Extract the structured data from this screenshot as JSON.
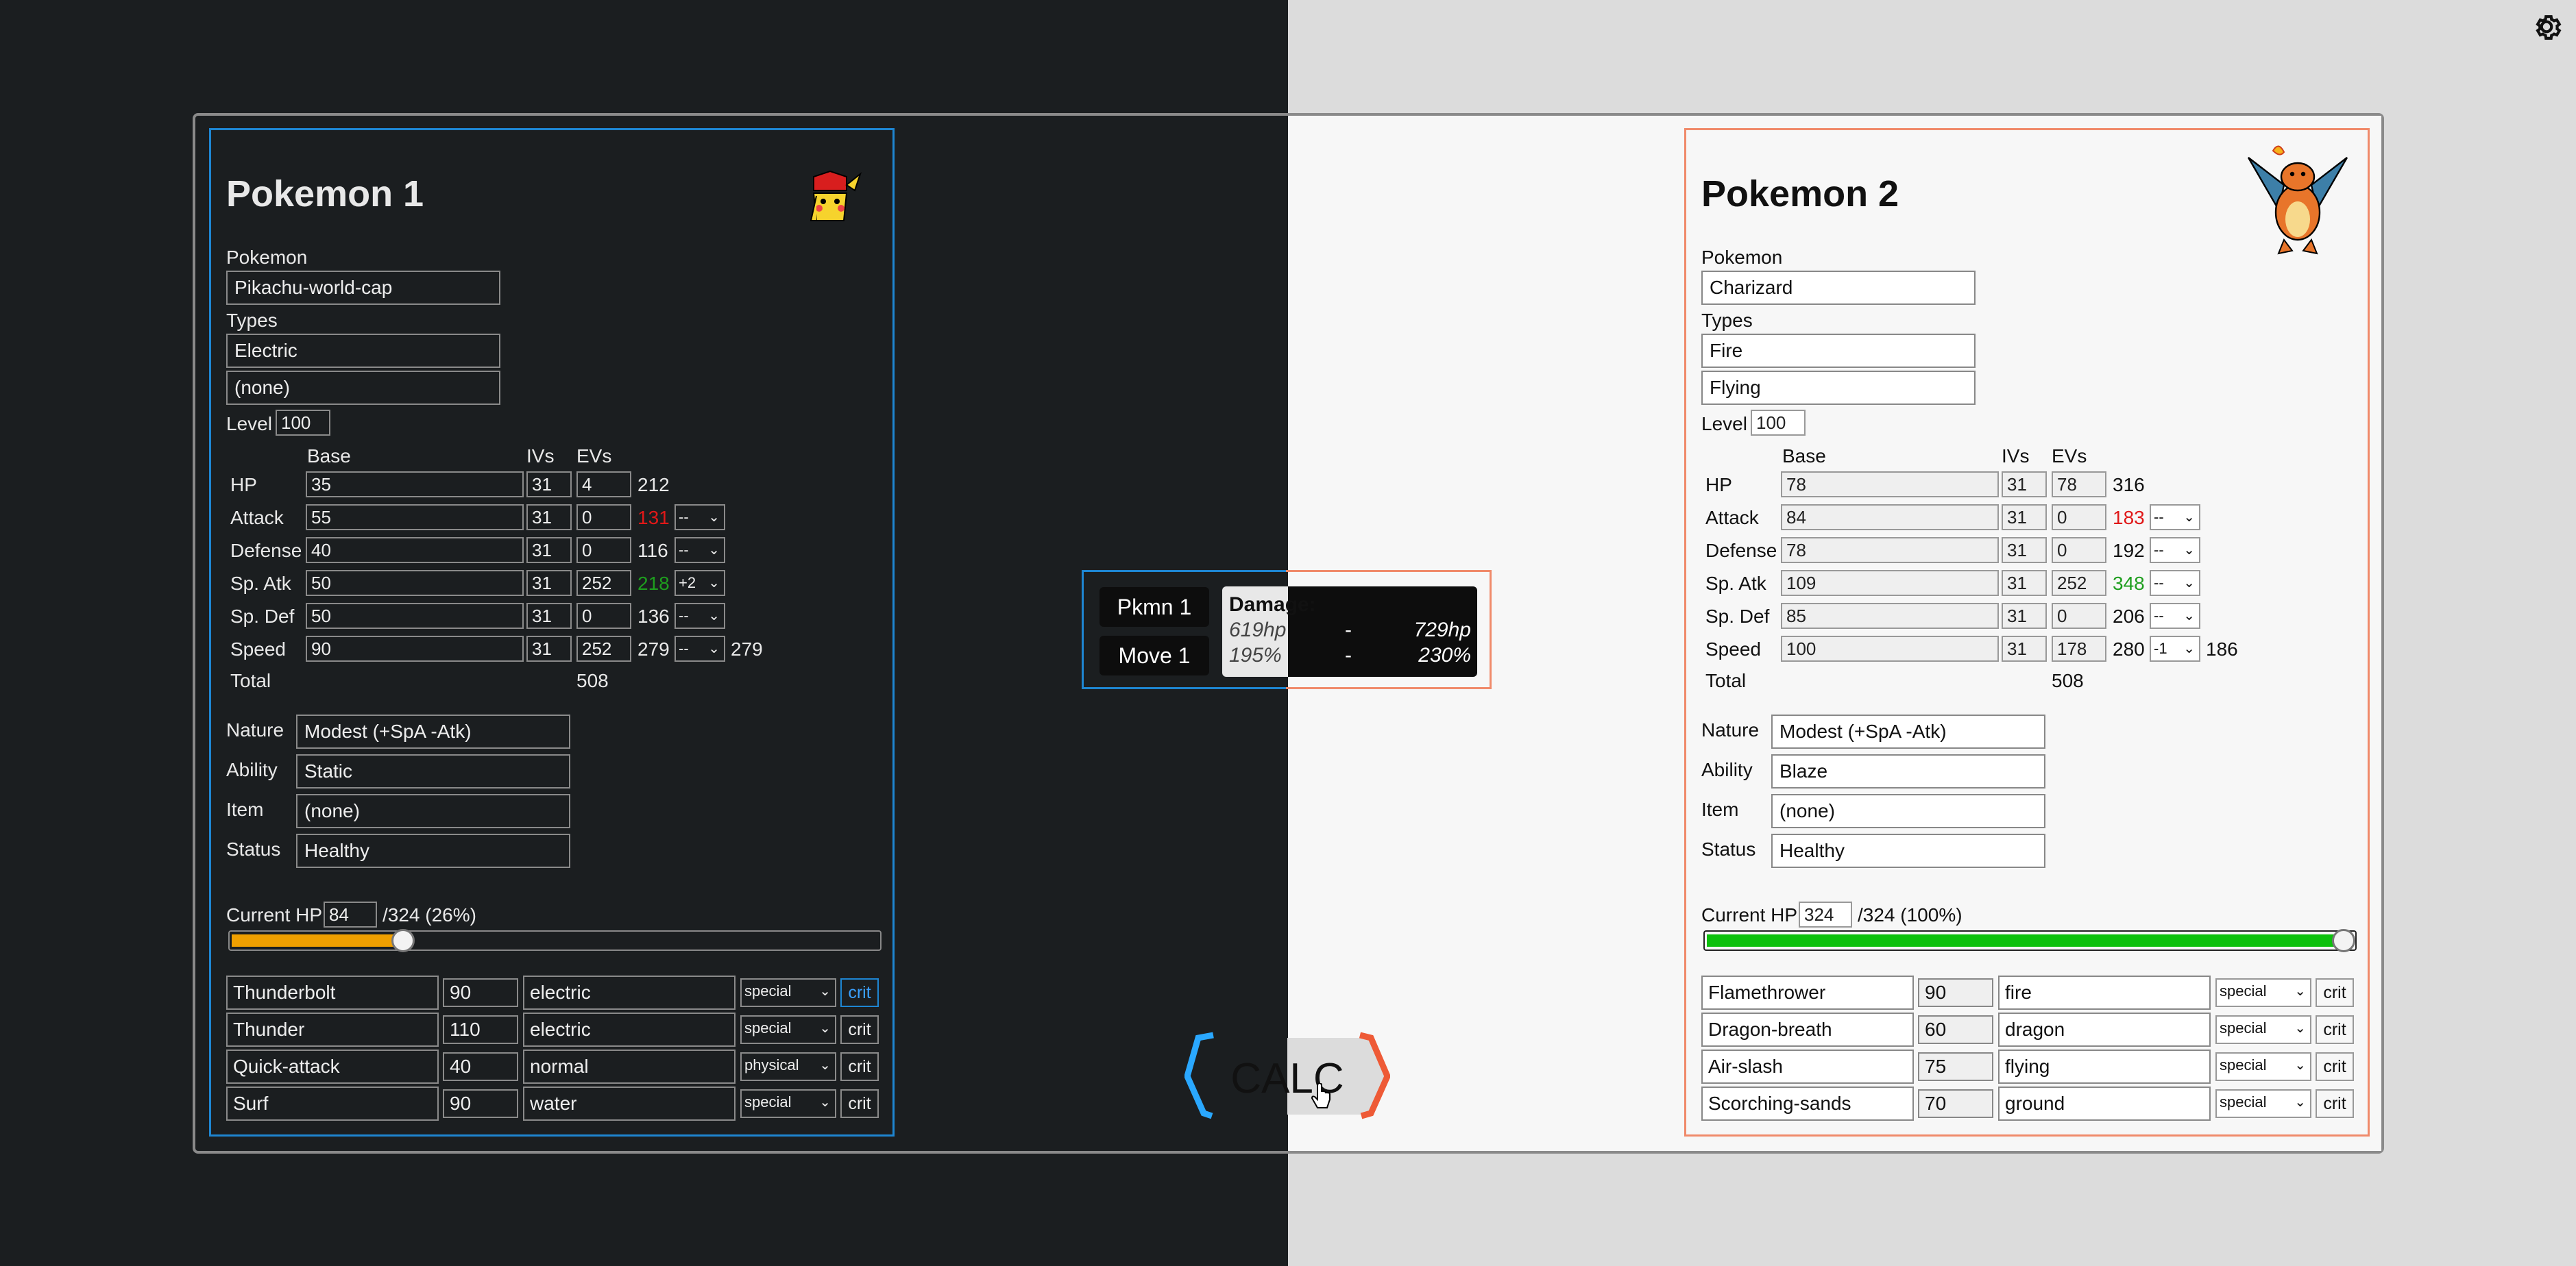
{
  "settings": {
    "icon": "gear-icon"
  },
  "pokemon1": {
    "title": "Pokemon 1",
    "pokemon_label": "Pokemon",
    "pokemon": "Pikachu-world-cap",
    "types_label": "Types",
    "type1": "Electric",
    "type2": "(none)",
    "level_label": "Level",
    "level": "100",
    "headers": {
      "base": "Base",
      "ivs": "IVs",
      "evs": "EVs"
    },
    "stats": [
      {
        "name": "HP",
        "base": "35",
        "iv": "31",
        "ev": "4",
        "value": "212",
        "boost": ""
      },
      {
        "name": "Attack",
        "base": "55",
        "iv": "31",
        "ev": "0",
        "value": "131",
        "boost": "--"
      },
      {
        "name": "Defense",
        "base": "40",
        "iv": "31",
        "ev": "0",
        "value": "116",
        "boost": "--"
      },
      {
        "name": "Sp. Atk",
        "base": "50",
        "iv": "31",
        "ev": "252",
        "value": "218",
        "boost": "+2"
      },
      {
        "name": "Sp. Def",
        "base": "50",
        "iv": "31",
        "ev": "0",
        "value": "136",
        "boost": "--"
      },
      {
        "name": "Speed",
        "base": "90",
        "iv": "31",
        "ev": "252",
        "value": "279",
        "boost": "--",
        "final": "279"
      }
    ],
    "total_label": "Total",
    "total_ev": "508",
    "nature_label": "Nature",
    "nature": "Modest (+SpA -Atk)",
    "ability_label": "Ability",
    "ability": "Static",
    "item_label": "Item",
    "item": "(none)",
    "status_label": "Status",
    "status": "Healthy",
    "hp_label": "Current HP",
    "current_hp": "84",
    "hp_suffix": "/324 (26%)",
    "hp_fraction": 0.26,
    "hp_color": "#f0a000",
    "moves": [
      {
        "name": "Thunderbolt",
        "power": "90",
        "type": "electric",
        "category": "special",
        "crit": "crit"
      },
      {
        "name": "Thunder",
        "power": "110",
        "type": "electric",
        "category": "special",
        "crit": "crit"
      },
      {
        "name": "Quick-attack",
        "power": "40",
        "type": "normal",
        "category": "physical",
        "crit": "crit"
      },
      {
        "name": "Surf",
        "power": "90",
        "type": "water",
        "category": "special",
        "crit": "crit"
      }
    ]
  },
  "pokemon2": {
    "title": "Pokemon 2",
    "pokemon_label": "Pokemon",
    "pokemon": "Charizard",
    "types_label": "Types",
    "type1": "Fire",
    "type2": "Flying",
    "level_label": "Level",
    "level": "100",
    "headers": {
      "base": "Base",
      "ivs": "IVs",
      "evs": "EVs"
    },
    "stats": [
      {
        "name": "HP",
        "base": "78",
        "iv": "31",
        "ev": "78",
        "value": "316",
        "boost": ""
      },
      {
        "name": "Attack",
        "base": "84",
        "iv": "31",
        "ev": "0",
        "value": "183",
        "boost": "--"
      },
      {
        "name": "Defense",
        "base": "78",
        "iv": "31",
        "ev": "0",
        "value": "192",
        "boost": "--"
      },
      {
        "name": "Sp. Atk",
        "base": "109",
        "iv": "31",
        "ev": "252",
        "value": "348",
        "boost": "--"
      },
      {
        "name": "Sp. Def",
        "base": "85",
        "iv": "31",
        "ev": "0",
        "value": "206",
        "boost": "--"
      },
      {
        "name": "Speed",
        "base": "100",
        "iv": "31",
        "ev": "178",
        "value": "280",
        "boost": "-1",
        "final": "186"
      }
    ],
    "total_label": "Total",
    "total_ev": "508",
    "nature_label": "Nature",
    "nature": "Modest (+SpA -Atk)",
    "ability_label": "Ability",
    "ability": "Blaze",
    "item_label": "Item",
    "item": "(none)",
    "status_label": "Status",
    "status": "Healthy",
    "hp_label": "Current HP",
    "current_hp": "324",
    "hp_suffix": "/324 (100%)",
    "hp_fraction": 1.0,
    "hp_color": "#0cc00c",
    "moves": [
      {
        "name": "Flamethrower",
        "power": "90",
        "type": "fire",
        "category": "special",
        "crit": "crit"
      },
      {
        "name": "Dragon-breath",
        "power": "60",
        "type": "dragon",
        "category": "special",
        "crit": "crit"
      },
      {
        "name": "Air-slash",
        "power": "75",
        "type": "flying",
        "category": "special",
        "crit": "crit"
      },
      {
        "name": "Scorching-sands",
        "power": "70",
        "type": "ground",
        "category": "special",
        "crit": "crit"
      }
    ]
  },
  "damage": {
    "pkmn_button": "Pkmn 1",
    "move_button": "Move 1",
    "title": "Damage:",
    "hp_min": "619hp",
    "hp_max": "729hp",
    "pct_min": "195%",
    "pct_max": "230%",
    "dash": "-"
  },
  "calc_button": "CALC"
}
